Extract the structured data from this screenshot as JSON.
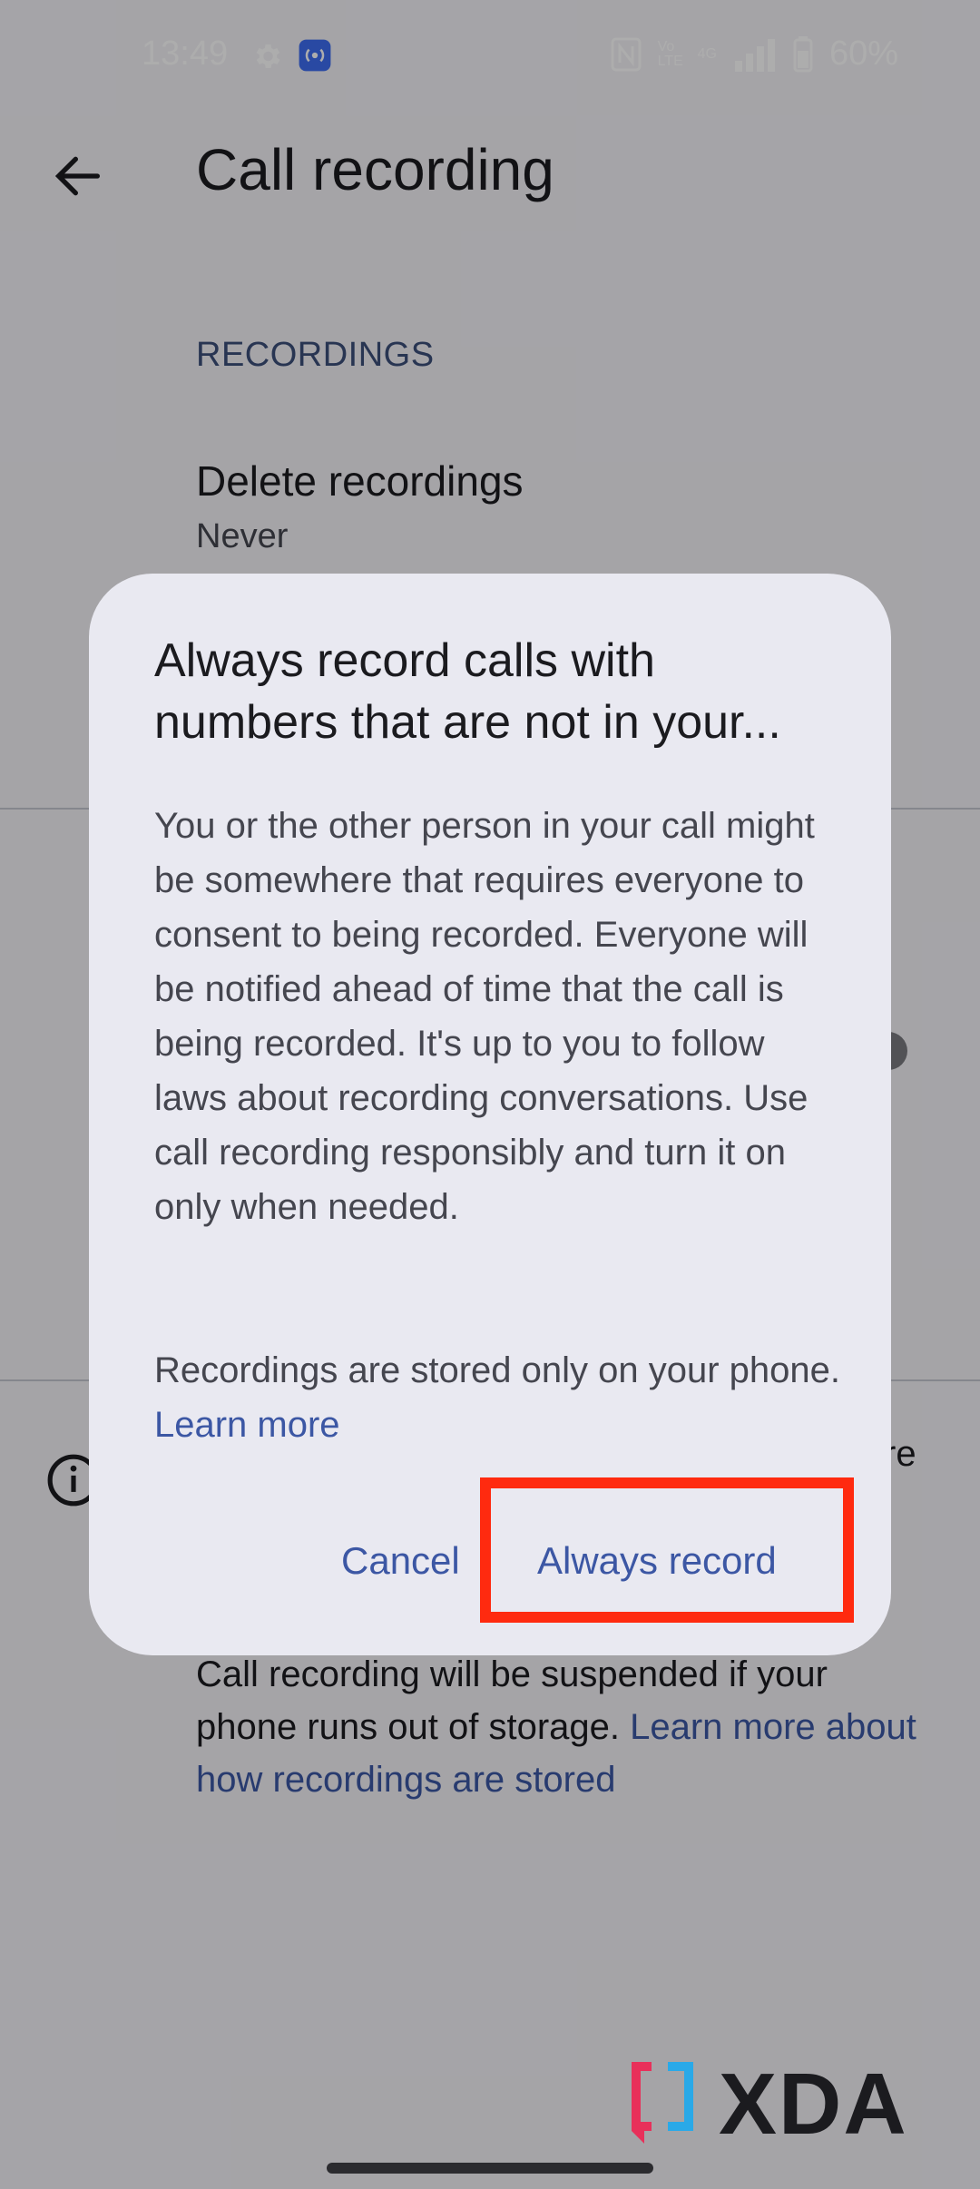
{
  "status_bar": {
    "time": "13:49",
    "battery": "60%",
    "volte_label": "Vo LTE",
    "network_label": "4G"
  },
  "app_bar": {
    "title": "Call recording"
  },
  "sections": {
    "recordings_header": "RECORDINGS",
    "delete_recordings_title": "Delete recordings",
    "delete_recordings_value": "Never",
    "info_fragment": "re"
  },
  "footer": {
    "text": "Call recording will be suspended if your phone runs out of storage. ",
    "link": "Learn more about how recordings are stored"
  },
  "dialog": {
    "title": "Always record calls with numbers that are not in your...",
    "body": "You or the other person in your call might be somewhere that requires everyone to consent to being recorded. Everyone will be notified ahead of time that the call is being recorded. It's up to you to follow laws about recording conversations. Use call recording responsibly and turn it on only when needed.",
    "storage_text": "Recordings are stored only on your phone. ",
    "storage_link": "Learn more",
    "cancel_label": "Cancel",
    "confirm_label": "Always record"
  },
  "watermark": {
    "text": "XDA"
  },
  "colors": {
    "accent": "#3c57a4",
    "highlight": "#ff2a0f",
    "dialog_bg": "#e9e9f1"
  }
}
